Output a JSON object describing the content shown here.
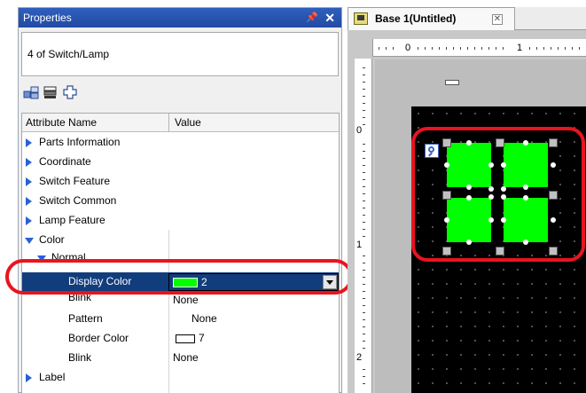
{
  "properties": {
    "title": "Properties",
    "pin_glyph": "ș",
    "close_glyph": "✕",
    "selection_label": "4 of Switch/Lamp",
    "toolbar_icons": [
      "categorize-icon",
      "sort-icon",
      "add-icon"
    ]
  },
  "grid": {
    "header": {
      "name": "Attribute Name",
      "value": "Value"
    },
    "rows": [
      {
        "label": "Parts Information",
        "expander": "collapsed"
      },
      {
        "label": "Coordinate",
        "expander": "collapsed"
      },
      {
        "label": "Switch Feature",
        "expander": "collapsed"
      },
      {
        "label": "Switch Common",
        "expander": "collapsed"
      },
      {
        "label": "Lamp Feature",
        "expander": "collapsed"
      },
      {
        "label": "Color",
        "expander": "expanded"
      },
      {
        "label": "Normal",
        "expander": "expanded"
      },
      {
        "label": "Display Color",
        "value": "2",
        "swatch_color": "#00ff00",
        "selected": true
      },
      {
        "label": "Blink",
        "value": "None"
      },
      {
        "label": "Pattern",
        "value": "None"
      },
      {
        "label": "Border Color",
        "value": "7",
        "swatch_color": "#ffffff"
      },
      {
        "label": "Blink",
        "value": "None"
      },
      {
        "label": "Label",
        "expander": "collapsed"
      }
    ]
  },
  "editor": {
    "tab_title": "Base 1(Untitled)",
    "tab_close_glyph": "✕",
    "ruler_top_labels": [
      "0",
      "1"
    ],
    "ruler_left_labels": [
      "0",
      "1",
      "2"
    ],
    "screen_color": "#000000",
    "lamp_color": "#00ff00"
  },
  "highlight_color": "#e8141f"
}
